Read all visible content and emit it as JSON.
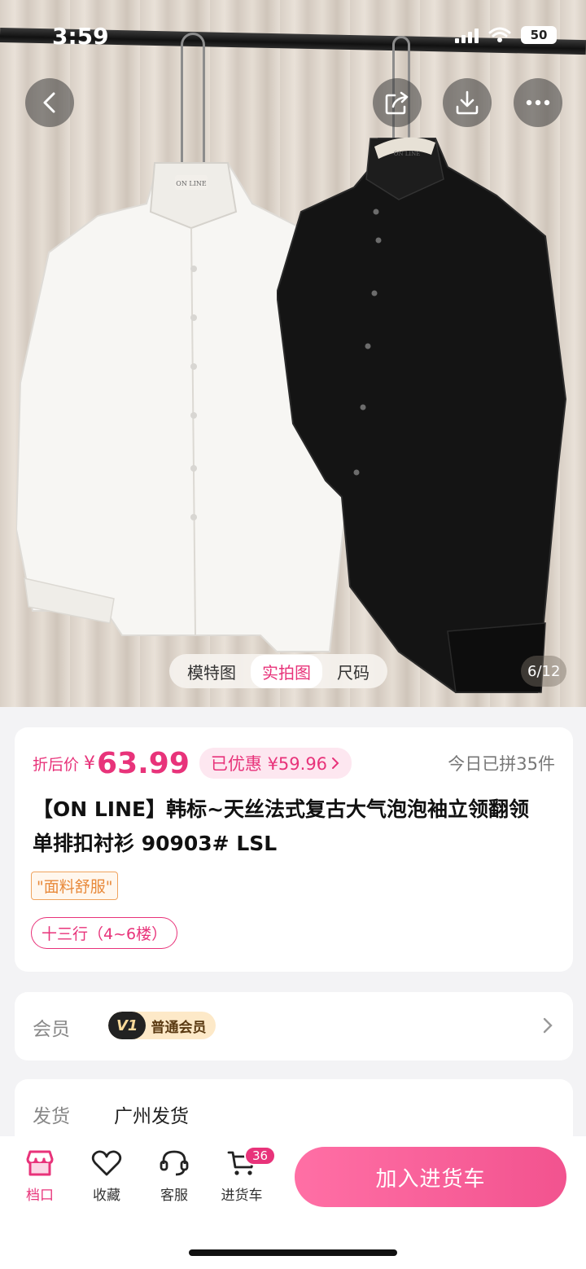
{
  "status_bar": {
    "time": "3:59",
    "battery": "50"
  },
  "hero": {
    "brand_label": "ON LINE",
    "tabs": [
      {
        "label": "模特图",
        "active": false
      },
      {
        "label": "实拍图",
        "active": true
      },
      {
        "label": "尺码",
        "active": false
      }
    ],
    "counter": "6/12"
  },
  "price": {
    "label": "折后价",
    "currency": "¥",
    "value": "63.99",
    "discount": "已优惠 ¥59.96",
    "sold_today": "今日已拼35件"
  },
  "product": {
    "title": "【ON LINE】韩标~天丝法式复古大气泡泡袖立领翻领单排扣衬衫  90903#  LSL",
    "tag_quality": "\"面料舒服\"",
    "tag_location": "十三行（4~6楼）"
  },
  "member": {
    "label": "会员",
    "badge": "V1",
    "level": "普通会员"
  },
  "shipping": {
    "label": "发货",
    "value": "广州发货"
  },
  "bottom_bar": {
    "items": [
      {
        "label": "档口",
        "active": true
      },
      {
        "label": "收藏",
        "active": false
      },
      {
        "label": "客服",
        "active": false
      },
      {
        "label": "进货车",
        "active": false
      }
    ],
    "cart_count": "36",
    "add_to_cart": "加入进货车"
  },
  "colors": {
    "accent": "#e8337a",
    "tag_orange": "#e8893a",
    "background": "#f3f3f5"
  }
}
